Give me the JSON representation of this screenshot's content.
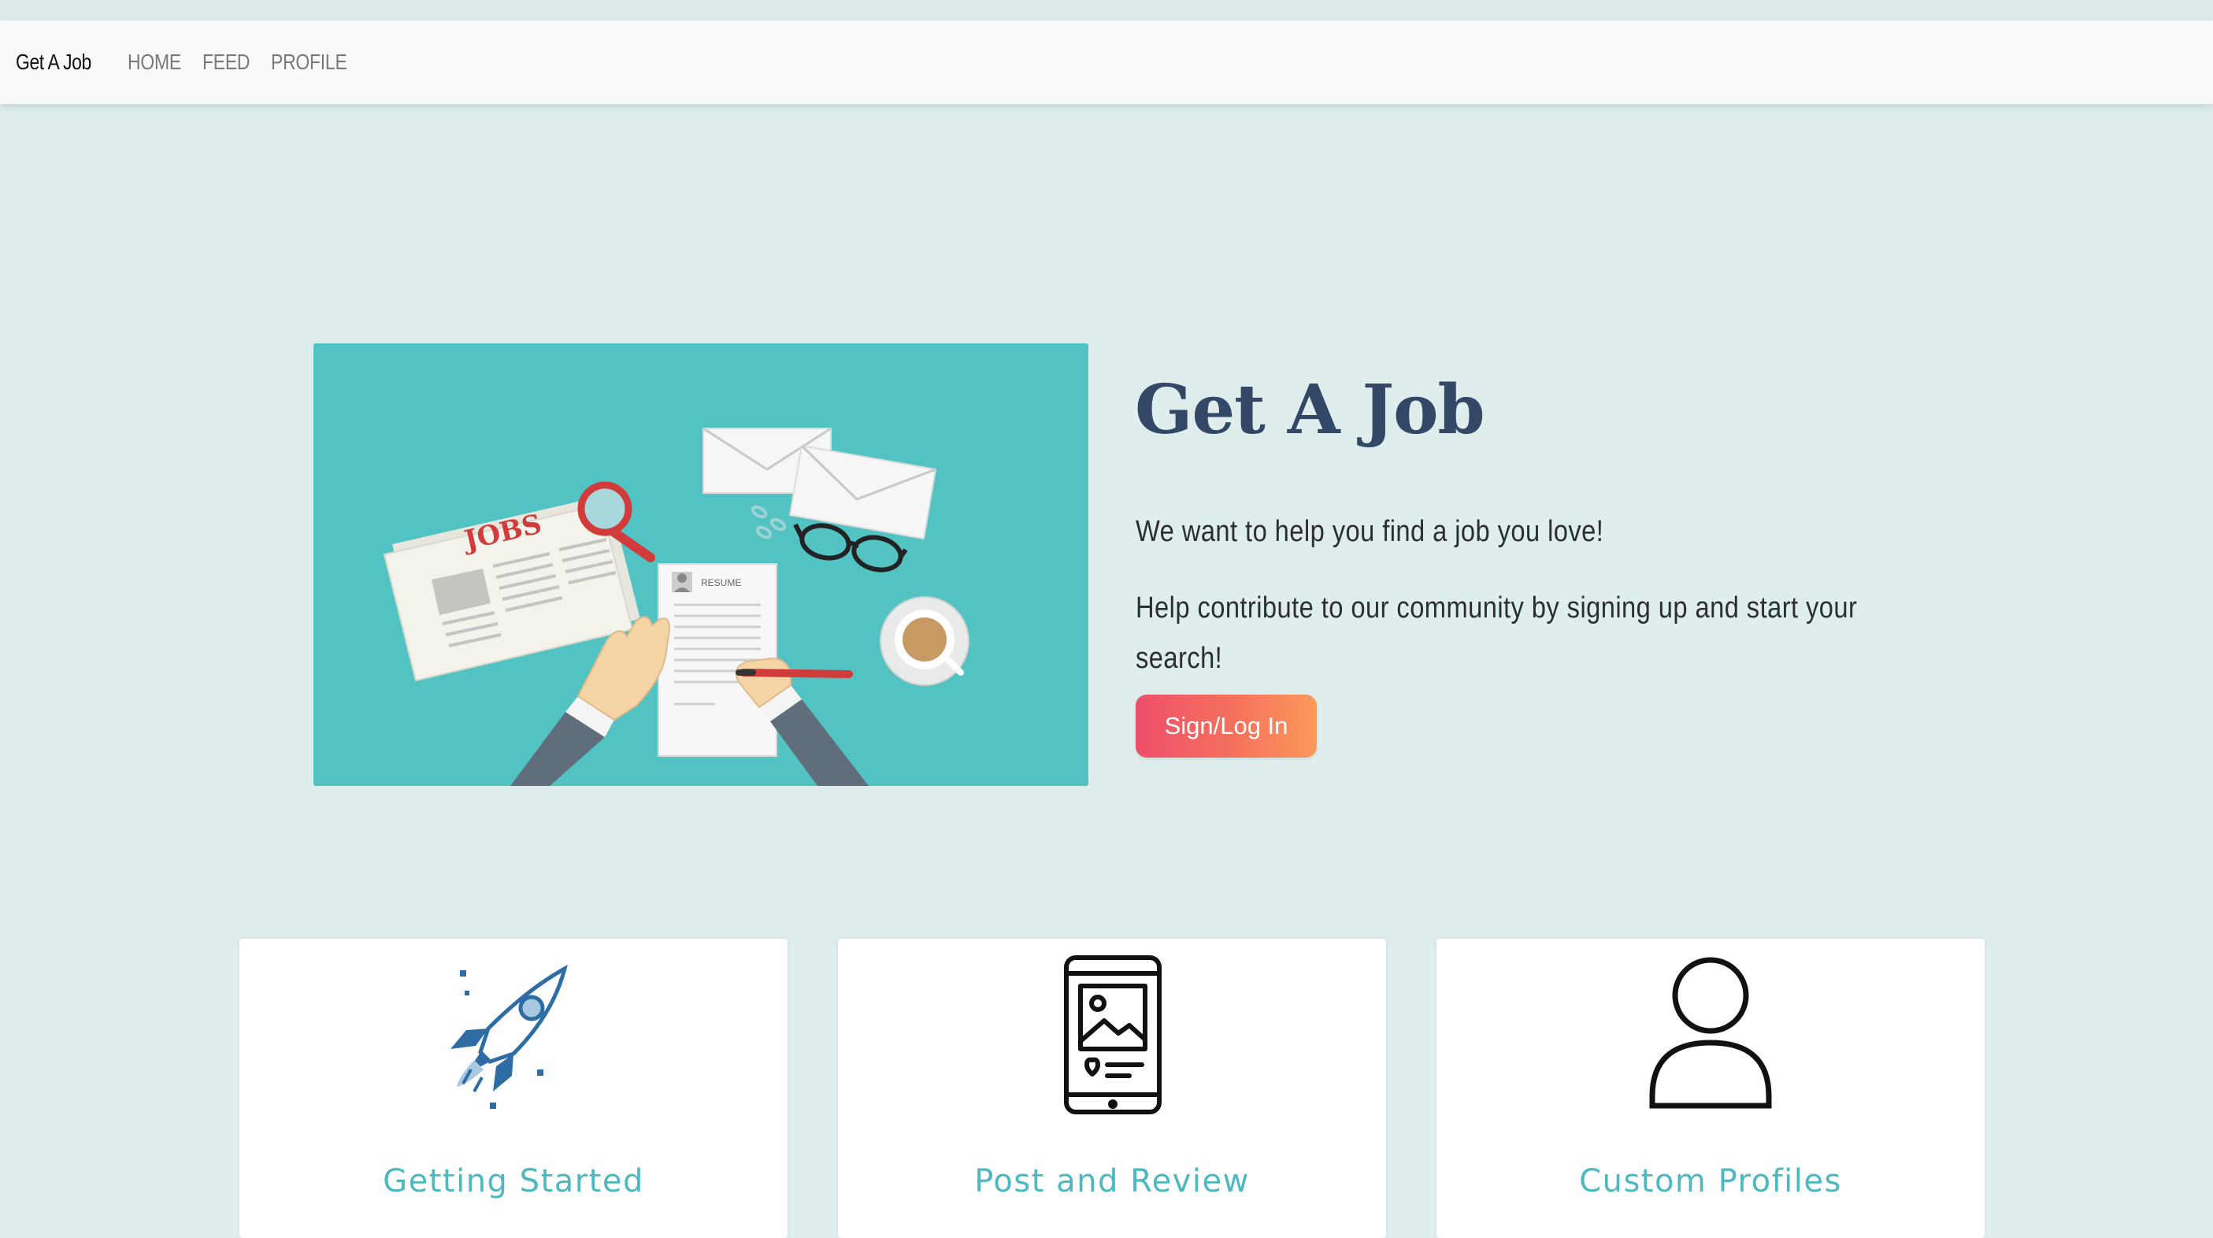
{
  "navbar": {
    "brand": "Get A Job",
    "links": [
      "HOME",
      "FEED",
      "PROFILE"
    ]
  },
  "hero": {
    "title": "Get A Job",
    "tagline": "We want to help you find a job you love!",
    "description": "Help contribute to our community by signing up and start your search!",
    "cta_label": "Sign/Log In",
    "illustration": {
      "newspaper_heading": "JOBS",
      "resume_label": "RESUME"
    }
  },
  "features": [
    {
      "title": "Getting Started",
      "icon": "rocket-icon"
    },
    {
      "title": "Post and Review",
      "icon": "mobile-post-icon"
    },
    {
      "title": "Custom Profiles",
      "icon": "user-profile-icon"
    }
  ],
  "colors": {
    "page_bg": "#dfeded",
    "navbar_bg": "#f7f9fa",
    "hero_bg": "#52c2c2",
    "title": "#334766",
    "card_title": "#4db8bf",
    "cta_gradient_start": "#ee4f6a",
    "cta_gradient_end": "#fb9a5b"
  }
}
